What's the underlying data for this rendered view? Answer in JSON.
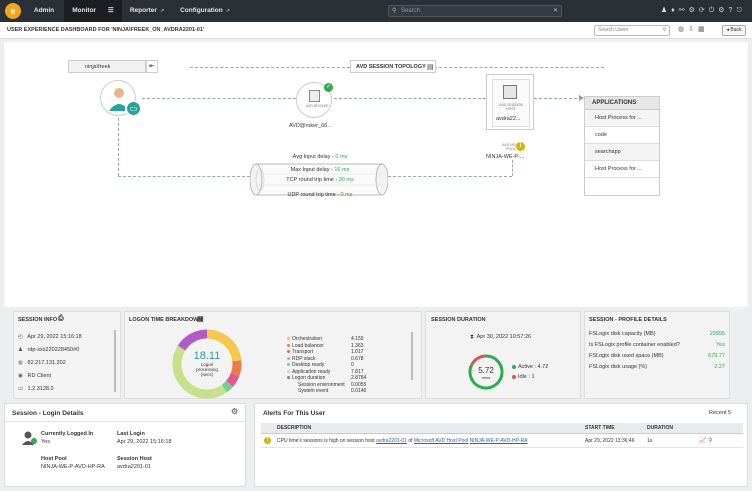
{
  "nav": {
    "admin": "Admin",
    "monitor": "Monitor",
    "reporter": "Reporter",
    "configuration": "Configuration",
    "search_placeholder": "Search"
  },
  "header": {
    "title": "USER EXPERIENCE DASHBOARD FOR 'NINJA\\FREEK_ON_AVDRA2201-01'",
    "search_users_placeholder": "Search Users",
    "back": "Back"
  },
  "topology": {
    "user_label": "ninja\\freek",
    "section_title": "AVD SESSION TOPOLOGY",
    "broker_icon_text": "AVD BROKER",
    "broker_label": "AVD@roker_66...",
    "host_icon_text": "AVD SESSION HOST",
    "host_name": "avdra22...",
    "pool_icon_text": "AVD HOST POOL",
    "pool_label": "NINJA-WE-P-...",
    "metrics": [
      {
        "label": "Avg Input delay",
        "value": "0 ms"
      },
      {
        "label": "Max Input delay",
        "value": "16 ms"
      },
      {
        "label": "TCP round trip time",
        "value": "30 ms"
      },
      {
        "label": "UDP round trip time",
        "value": "0 ms"
      }
    ],
    "applications_title": "APPLICATIONS",
    "applications": [
      "Host Process for ...",
      "code",
      "searchapp",
      "Host Process for ..."
    ]
  },
  "session_info": {
    "title": "SESSION INFO",
    "start": "Apr 29, 2022 15:16:18",
    "user": "rdp-sxs220228450#0",
    "ip": "82.217.131.202",
    "client": "RD Client",
    "version": "1.2.3128.0"
  },
  "logon": {
    "title": "LOGON TIME BREAKDOWN",
    "total": "18.11",
    "caption1": "Logon",
    "caption2": "processing",
    "caption3": "(secs)",
    "items": [
      {
        "label": "Orchestration",
        "value": "4.159",
        "color": "#f2c94c",
        "frac": 0.23
      },
      {
        "label": "Load balancer",
        "value": "1.363",
        "color": "#eb7b4a",
        "frac": 0.075
      },
      {
        "label": "Transport",
        "value": "1.017",
        "color": "#e05a8f",
        "frac": 0.056
      },
      {
        "label": "RDP stack",
        "value": "0.678",
        "color": "#6fcf97",
        "frac": 0.037
      },
      {
        "label": "Desktop ready",
        "value": "0",
        "color": "#56ccf2",
        "frac": 0
      },
      {
        "label": "Application ready",
        "value": "7.817",
        "color": "#c7e08a",
        "frac": 0.432
      },
      {
        "label": "Logon duration",
        "value": "2.8784",
        "color": "#b05cc4",
        "frac": 0.159
      },
      {
        "label": "Session environment",
        "value": "0.0055",
        "color": "",
        "frac": 0
      },
      {
        "label": "System event",
        "value": "0.0146",
        "color": "",
        "frac": 0
      }
    ]
  },
  "duration": {
    "title": "SESSION DURATION",
    "start": "Apr 30, 2022 10:57:26",
    "value": "5.72",
    "unit": "mins",
    "active_label": "Active : 4.72",
    "idle_label": "Idle : 1",
    "active_frac": 0.825
  },
  "profile": {
    "title": "SESSION - PROFILE DETAILS",
    "rows": [
      {
        "label": "FSLogix disk capacity (MB)",
        "value": "29995"
      },
      {
        "label": "Is FSLogix profile container enabled?",
        "value": "Yes"
      },
      {
        "label": "FSLogix disk used space (MB)",
        "value": "679.77"
      },
      {
        "label": "FSLogix disk usage (%)",
        "value": "2.27"
      }
    ]
  },
  "login": {
    "title": "Session - Login Details",
    "logged_label": "Currently Logged In",
    "logged_value": "Yes",
    "last_label": "Last Login",
    "last_value": "Apr 29, 2022 15:16:18",
    "pool_label": "Host Pool",
    "pool_value": "NINJA-WE-P-AVD-HP-RA",
    "host_label": "Session Host",
    "host_value": "avdra2201-01"
  },
  "alerts": {
    "title": "Alerts For This User",
    "recent": "Recent 5",
    "col_description": "DESCRIPTION",
    "col_start": "START TIME",
    "col_duration": "DURATION",
    "row_text1": "CPU time's sessions is high on session host",
    "row_link1": "avdra2201-01",
    "row_text2": "of",
    "row_link2": "Microsoft AVD Host Pool",
    "row_link3": "NINJA-WE-P-AVD-HP-RA",
    "row_start": "Apr 29, 2022 13:36:46",
    "row_duration": "1s"
  },
  "colors": {
    "accent": "#f0a71f",
    "ok": "#2eab4f",
    "teal": "#2aa19b",
    "warn": "#d6b500"
  }
}
